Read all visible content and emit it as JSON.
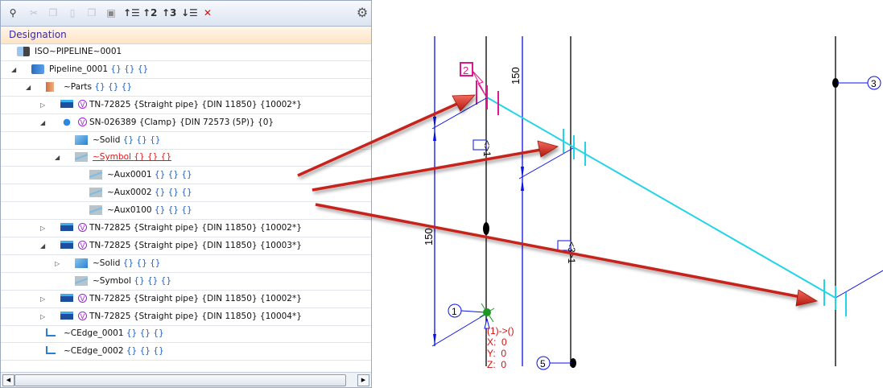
{
  "toolbar": {
    "icons": [
      "search-binoculars-icon",
      "cut-icon",
      "copy-icon",
      "paste-icon",
      "copy-special-icon",
      "paste-special-icon",
      "sort-level1-icon",
      "sort-level2-icon",
      "sort-level3-icon",
      "sort-down-icon",
      "clear-sort-icon"
    ],
    "settings_icon": "gear-icon"
  },
  "header": {
    "column": "Designation"
  },
  "tree": [
    {
      "name": "ISO~PIPELINE~0001",
      "suffix": "",
      "level": 0,
      "expander": "",
      "icon": "iso-folder-icon"
    },
    {
      "name": "Pipeline_0001",
      "suffix": "{} {} {}",
      "level": 1,
      "expander": "expanded",
      "icon": "pipeline-icon"
    },
    {
      "name": "~Parts",
      "suffix": "{} {} {}",
      "level": 2,
      "expander": "expanded",
      "icon": "parts-icon"
    },
    {
      "name": "TN-72825 {Straight pipe} {DIN 11850} {10002*}",
      "suffix": "",
      "level": 3,
      "expander": "collapsed",
      "icon": "pipe-icon",
      "v": "V"
    },
    {
      "name": "SN-026389 {Clamp} {DIN 72573 (5P)} {0}",
      "suffix": "",
      "level": 3,
      "expander": "expanded",
      "icon": "clamp-icon",
      "v": "V"
    },
    {
      "name": "~Solid",
      "suffix": "{} {} {}",
      "level": 4,
      "expander": "",
      "icon": "solid-icon"
    },
    {
      "name": "~Symbol",
      "suffix": "{} {} {}",
      "level": 4,
      "expander": "expanded",
      "icon": "symbol-icon",
      "selected": true
    },
    {
      "name": "~Aux0001",
      "suffix": "{} {} {}",
      "level": 5,
      "expander": "",
      "icon": "symbol-icon"
    },
    {
      "name": "~Aux0002",
      "suffix": "{} {} {}",
      "level": 5,
      "expander": "",
      "icon": "symbol-icon"
    },
    {
      "name": "~Aux0100",
      "suffix": "{} {} {}",
      "level": 5,
      "expander": "",
      "icon": "symbol-icon"
    },
    {
      "name": "TN-72825 {Straight pipe} {DIN 11850} {10002*}",
      "suffix": "",
      "level": 3,
      "expander": "collapsed",
      "icon": "pipe-icon",
      "v": "V"
    },
    {
      "name": "TN-72825 {Straight pipe} {DIN 11850} {10003*}",
      "suffix": "",
      "level": 3,
      "expander": "expanded",
      "icon": "pipe-icon",
      "v": "V"
    },
    {
      "name": "~Solid",
      "suffix": "{} {} {}",
      "level": 4,
      "expander": "collapsed",
      "icon": "solid-icon"
    },
    {
      "name": "~Symbol",
      "suffix": "{} {} {}",
      "level": 4,
      "expander": "",
      "icon": "symbol-icon"
    },
    {
      "name": "TN-72825 {Straight pipe} {DIN 11850} {10002*}",
      "suffix": "",
      "level": 3,
      "expander": "collapsed",
      "icon": "pipe-icon",
      "v": "V"
    },
    {
      "name": "TN-72825 {Straight pipe} {DIN 11850} {10004*}",
      "suffix": "",
      "level": 3,
      "expander": "collapsed",
      "icon": "pipe-icon",
      "v": "V"
    },
    {
      "name": "~CEdge_0001",
      "suffix": "{} {} {}",
      "level": 2,
      "expander": "",
      "icon": "cedge-icon"
    },
    {
      "name": "~CEdge_0002",
      "suffix": "{} {} {}",
      "level": 2,
      "expander": "",
      "icon": "cedge-icon"
    }
  ],
  "drawing": {
    "dim_top": "150",
    "dim_left": "150",
    "label_1": "1",
    "label_2": "2",
    "label_3": "3",
    "label_5": "5",
    "tag_1": "<>1",
    "tag_3": "<3>1",
    "coord_title": "(1)->()",
    "coord_x": "X:  0",
    "coord_y": "Y:  0",
    "coord_z": "Z:  0"
  },
  "colors": {
    "arrow": "#d42b20",
    "pipe": "#22d4e8",
    "dim": "#0a10e8",
    "node_label": "#e0178a",
    "coord": "#d01010"
  }
}
